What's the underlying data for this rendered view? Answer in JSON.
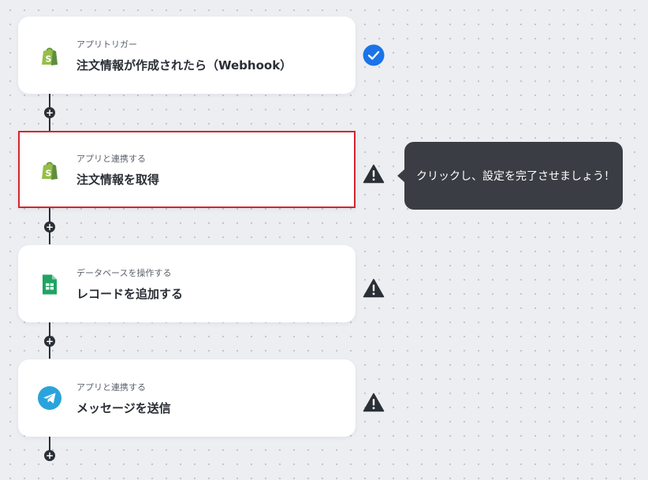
{
  "steps": [
    {
      "subtitle": "アプリトリガー",
      "title": "注文情報が作成されたら（Webhook）",
      "app_icon": "shopify-icon",
      "status": "check-icon"
    },
    {
      "subtitle": "アプリと連携する",
      "title": "注文情報を取得",
      "app_icon": "shopify-icon",
      "status": "warning-icon"
    },
    {
      "subtitle": "データベースを操作する",
      "title": "レコードを追加する",
      "app_icon": "google-sheets-icon",
      "status": "warning-icon"
    },
    {
      "subtitle": "アプリと連携する",
      "title": "メッセージを送信",
      "app_icon": "telegram-icon",
      "status": "warning-icon"
    }
  ],
  "add_step_symbol": "+",
  "tooltip": {
    "text": "クリックし、設定を完了させましょう！"
  },
  "colors": {
    "selected_border": "#d6242e",
    "check_blue": "#1a73e8",
    "shopify_green": "#95bf47",
    "sheets_green": "#1fa463",
    "telegram_blue": "#2aa3dc",
    "tooltip_bg": "#3a3d43"
  }
}
